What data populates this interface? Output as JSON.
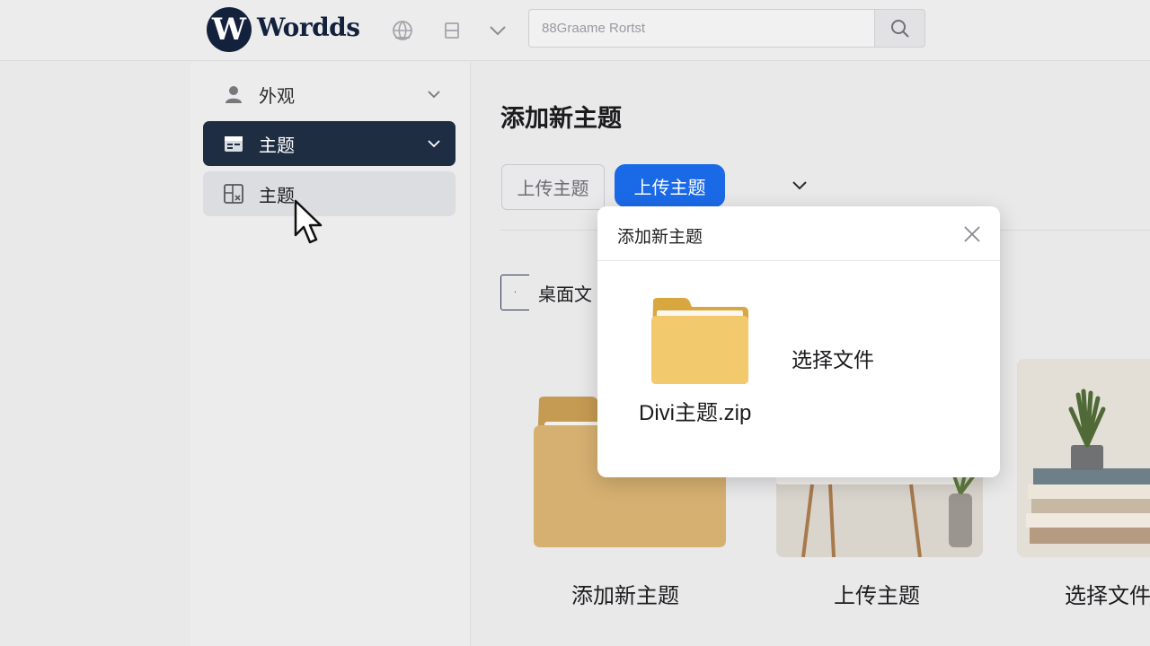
{
  "header": {
    "logo_letter": "W",
    "app_name": "Wordds",
    "search_value": "88Graame Rortst",
    "icons": [
      "globe-icon",
      "list-icon",
      "chevron-down-icon",
      "search-icon"
    ]
  },
  "sidebar": {
    "items": [
      {
        "label": "外观",
        "icon": "user-icon",
        "state": "collapsed"
      },
      {
        "label": "主题",
        "icon": "calendar-icon",
        "state": "active"
      },
      {
        "label": "主题",
        "icon": "layout-icon",
        "state": "hover"
      }
    ]
  },
  "main": {
    "title": "添加新主题",
    "upload_outline_label": "上传主题",
    "upload_primary_label": "上传主题",
    "desktop_label": "桌面文",
    "desktop_chip": "·",
    "cards": [
      {
        "label": "添加新主题",
        "image": "folder-illustration"
      },
      {
        "label": "上传主题",
        "image": "room-photo"
      },
      {
        "label": "选择文件",
        "image": "books-plant-photo"
      }
    ]
  },
  "dialog": {
    "title": "添加新主题",
    "file_name": "Divi主题.zip",
    "choose_label": "选择文件"
  },
  "colors": {
    "brand_navy": "#13213c",
    "active_sidebar": "#1f2d42",
    "primary_button": "#1a6ae8",
    "folder_yellow": "#f1c76a"
  }
}
